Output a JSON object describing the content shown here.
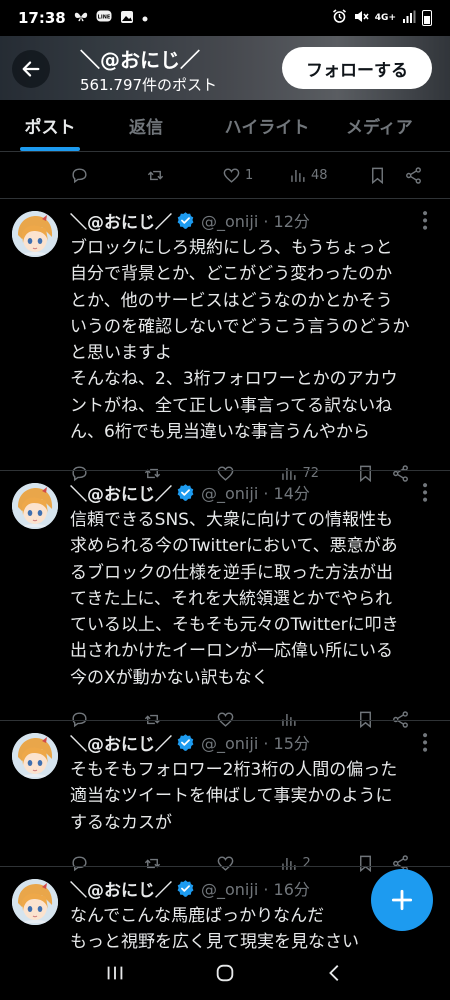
{
  "status_bar": {
    "time": "17:38",
    "left_icons": [
      "butterfly-icon",
      "line-icon",
      "gallery-icon",
      "dot-icon"
    ],
    "network": "4G+",
    "right_icons": [
      "alarm-icon",
      "mute-icon",
      "signal-icon",
      "battery-icon"
    ]
  },
  "header": {
    "display_name": "＼@おにじ／",
    "post_count": "561.797件のポスト",
    "follow_label": "フォローする"
  },
  "tabs": [
    {
      "label": "ポスト",
      "active": true
    },
    {
      "label": "返信",
      "active": false
    },
    {
      "label": "ハイライト",
      "active": false
    },
    {
      "label": "メディア",
      "active": false
    }
  ],
  "top_action_bar": {
    "likes": "1",
    "views": "48"
  },
  "tweets": [
    {
      "name": "＼@おにじ／",
      "handle": "@_oniji · 12分",
      "lines": [
        "ブロックにしろ規約にしろ、もうちょっと",
        "自分で背景とか、どこがどう変わったのか",
        "とか、他のサービスはどうなのかとかそう",
        "いうのを確認しないでどうこう言うのどうか",
        "と思いますよ",
        "そんなね、2、3桁フォロワーとかのアカウ",
        "ントがね、全て正しい事言ってる訳ないね",
        "ん、6桁でも見当違いな事言うんやから"
      ],
      "views": "72"
    },
    {
      "name": "＼@おにじ／",
      "handle": "@_oniji · 14分",
      "lines": [
        "信頼できるSNS、大衆に向けての情報性も",
        "求められる今のTwitterにおいて、悪意があ",
        "るブロックの仕様を逆手に取った方法が出",
        "てきた上に、それを大統領選とかでやられ",
        "ている以上、そもそも元々のTwitterに叩き",
        "出されかけたイーロンが一応偉い所にいる",
        "今のXが動かない訳もなく"
      ],
      "views": ""
    },
    {
      "name": "＼@おにじ／",
      "handle": "@_oniji · 15分",
      "lines": [
        "そもそもフォロワー2桁3桁の人間の偏った",
        "適当なツイートを伸ばして事実かのように",
        "するなカスが"
      ],
      "views": "2"
    },
    {
      "name": "＼@おにじ／",
      "handle": "@_oniji · 16分",
      "lines": [
        "なんでこんな馬鹿ばっかりなんだ",
        "もっと視野を広く見て現実を見なさい"
      ]
    }
  ],
  "colors": {
    "background": "#000000",
    "accent": "#1d9bf0",
    "secondary_text": "#71767b",
    "divider": "#2f3336"
  }
}
